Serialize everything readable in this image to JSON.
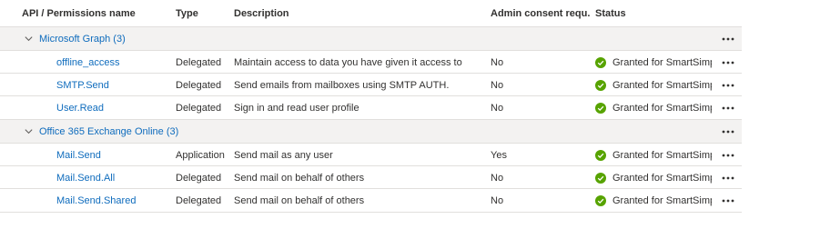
{
  "columns": {
    "api": "API / Permissions name",
    "type": "Type",
    "description": "Description",
    "admin": "Admin consent requ...",
    "status": "Status"
  },
  "groups": [
    {
      "label": "Microsoft Graph (3)",
      "items": [
        {
          "name": "offline_access",
          "type": "Delegated",
          "description": "Maintain access to data you have given it access to",
          "admin": "No",
          "status": "Granted for SmartSimpl..."
        },
        {
          "name": "SMTP.Send",
          "type": "Delegated",
          "description": "Send emails from mailboxes using SMTP AUTH.",
          "admin": "No",
          "status": "Granted for SmartSimpl..."
        },
        {
          "name": "User.Read",
          "type": "Delegated",
          "description": "Sign in and read user profile",
          "admin": "No",
          "status": "Granted for SmartSimpl..."
        }
      ]
    },
    {
      "label": "Office 365 Exchange Online (3)",
      "items": [
        {
          "name": "Mail.Send",
          "type": "Application",
          "description": "Send mail as any user",
          "admin": "Yes",
          "status": "Granted for SmartSimpl..."
        },
        {
          "name": "Mail.Send.All",
          "type": "Delegated",
          "description": "Send mail on behalf of others",
          "admin": "No",
          "status": "Granted for SmartSimpl..."
        },
        {
          "name": "Mail.Send.Shared",
          "type": "Delegated",
          "description": "Send mail on behalf of others",
          "admin": "No",
          "status": "Granted for SmartSimpl..."
        }
      ]
    }
  ],
  "colors": {
    "link": "#0f6cbd",
    "granted": "#57a300",
    "group_bg": "#f3f2f1"
  },
  "icons": {
    "group_toggle": "chevron-down-icon",
    "status": "check-circle-icon",
    "menu": "more-icon"
  }
}
